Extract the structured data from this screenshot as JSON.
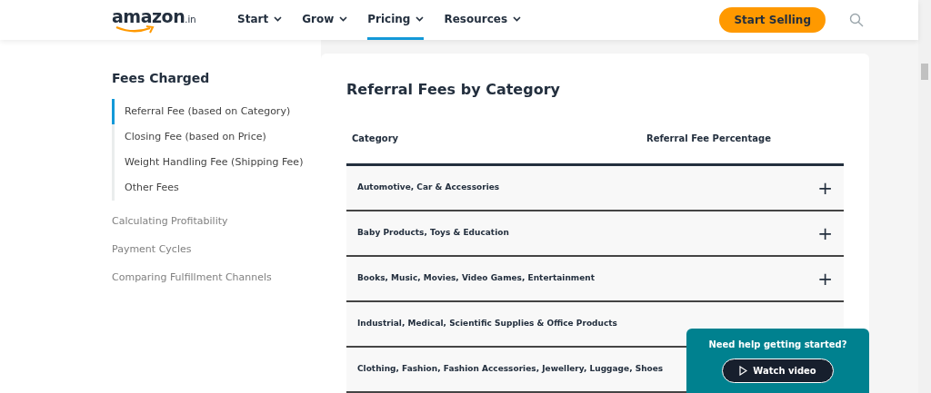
{
  "header": {
    "logo": {
      "wordmark": "amazon",
      "suffix": ".in"
    },
    "nav": [
      {
        "label": "Start",
        "selected": false
      },
      {
        "label": "Grow",
        "selected": false
      },
      {
        "label": "Pricing",
        "selected": true
      },
      {
        "label": "Resources",
        "selected": false
      }
    ],
    "cta": "Start Selling"
  },
  "sidebar": {
    "title": "Fees Charged",
    "sub_items": [
      {
        "label": "Referral Fee (based on Category)",
        "selected": true
      },
      {
        "label": "Closing Fee (based on Price)",
        "selected": false
      },
      {
        "label": "Weight Handling Fee (Shipping Fee)",
        "selected": false
      },
      {
        "label": "Other Fees",
        "selected": false
      }
    ],
    "sections": [
      "Calculating Profitability",
      "Payment Cycles",
      "Comparing Fulfillment Channels"
    ]
  },
  "content": {
    "title": "Referral Fees by Category",
    "table": {
      "columns": [
        "Category",
        "Referral Fee Percentage"
      ],
      "rows": [
        {
          "category": "Automotive, Car & Accessories",
          "expand": "+"
        },
        {
          "category": "Baby Products, Toys & Education",
          "expand": "+"
        },
        {
          "category": "Books, Music, Movies, Video Games, Entertainment",
          "expand": "+"
        },
        {
          "category": "Industrial, Medical, Scientific Supplies & Office Products"
        },
        {
          "category": "Clothing, Fashion, Fashion Accessories, Jewellery, Luggage, Shoes"
        }
      ]
    }
  },
  "help_popup": {
    "text": "Need help getting started?",
    "button": "Watch video"
  }
}
